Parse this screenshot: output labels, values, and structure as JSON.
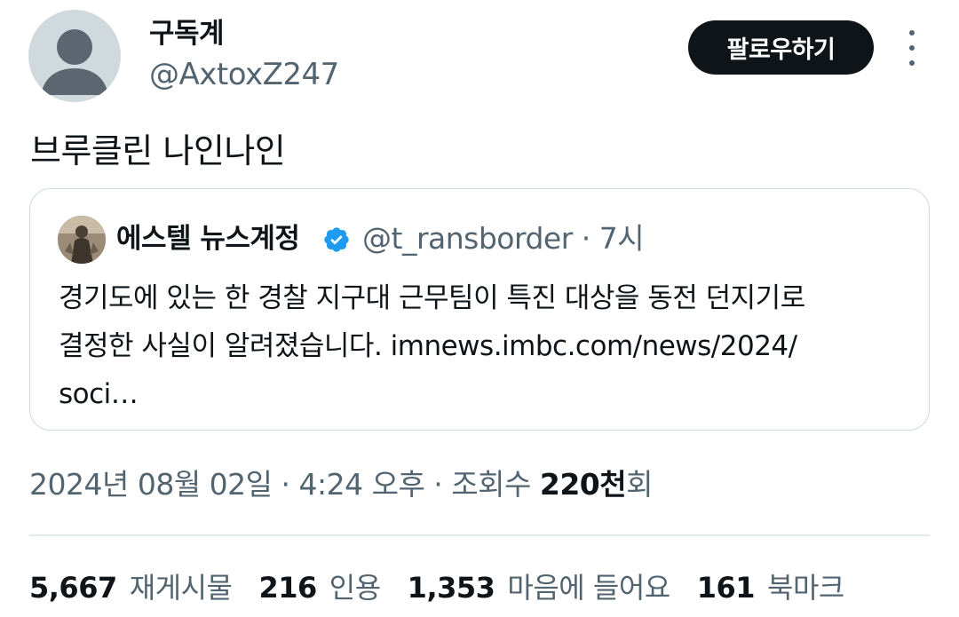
{
  "author": {
    "display_name": "구독계",
    "handle": "@AxtoxZ247"
  },
  "follow_button": {
    "label": "팔로우하기"
  },
  "more_button": {
    "icon": "more-vertical-icon"
  },
  "tweet": {
    "text": "브루클린 나인나인"
  },
  "quoted": {
    "display_name": "에스텔 뉴스계정",
    "verified_icon": "verified-badge-icon",
    "verified_color": "#1d9bf0",
    "handle_time": "@t_ransborder · 7시",
    "body_line1": "경기도에 있는 한 경찰 지구대 근무팀이 특진 대상을 동전 던지기로",
    "body_line2": "결정한 사실이 알려졌습니다. imnews.imbc.com/news/2024/",
    "body_line3": "soci…"
  },
  "meta": {
    "date_time": "2024년 08월 02일 · 4:24 오후 · 조회수 ",
    "views_value": "220천",
    "views_suffix": "회"
  },
  "stats": [
    {
      "value": "5,667",
      "label": "재게시물"
    },
    {
      "value": "216",
      "label": "인용"
    },
    {
      "value": "1,353",
      "label": "마음에 들어요"
    },
    {
      "value": "161",
      "label": "북마크"
    }
  ]
}
